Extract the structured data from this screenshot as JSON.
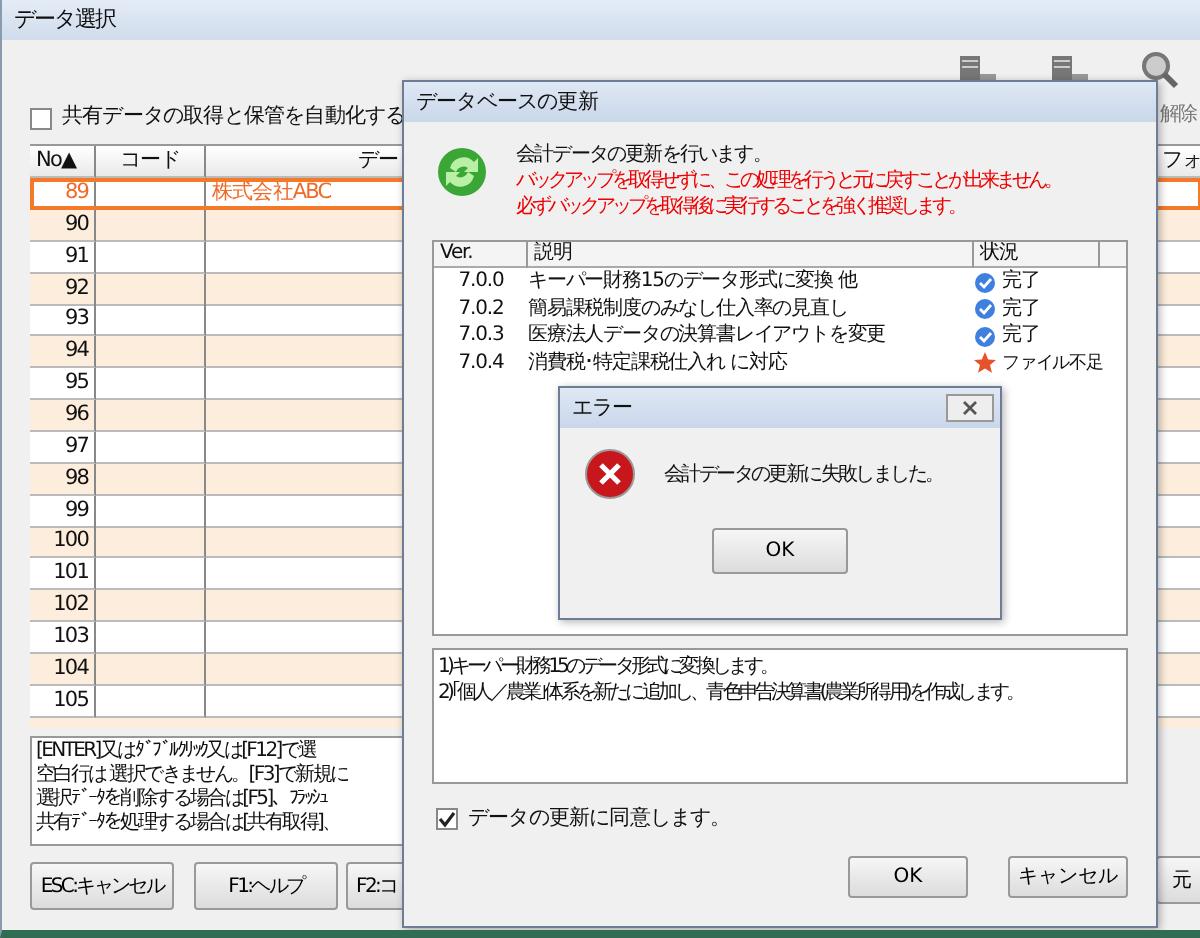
{
  "window": {
    "title": "データ選択"
  },
  "toolbar": {
    "label": "解除"
  },
  "auto_share": {
    "label": "共有データの取得と保管を自動化する",
    "checked": false
  },
  "table": {
    "columns": [
      "No▲",
      "コード",
      "デー",
      "フォ"
    ],
    "rows": [
      {
        "no": "89",
        "name": "株式会社ABC",
        "selected": true
      },
      {
        "no": "90",
        "selected": false
      },
      {
        "no": "91",
        "selected": false
      },
      {
        "no": "92",
        "selected": false
      },
      {
        "no": "93",
        "selected": false
      },
      {
        "no": "94",
        "selected": false
      },
      {
        "no": "95",
        "selected": false
      },
      {
        "no": "96",
        "selected": false
      },
      {
        "no": "97",
        "selected": false
      },
      {
        "no": "98",
        "selected": false
      },
      {
        "no": "99",
        "selected": false
      },
      {
        "no": "100",
        "selected": false
      },
      {
        "no": "101",
        "selected": false
      },
      {
        "no": "102",
        "selected": false
      },
      {
        "no": "103",
        "selected": false
      },
      {
        "no": "104",
        "selected": false
      },
      {
        "no": "105",
        "selected": false
      }
    ]
  },
  "help_lines": [
    "[ENTER]又はﾀﾞﾌﾞﾙｸﾘｯｸ又は[F12]で選",
    "空白行は 選択できません。[F3]で新規に",
    "選択ﾃﾞｰﾀを削除する場合は[F5]、ﾌﾗｯｼｭ",
    "共有ﾃﾞｰﾀを処理する場合は[共有取得]、"
  ],
  "buttons": [
    "ESC:キャンセル",
    "F1:ヘルプ",
    "F2:コ"
  ],
  "right_button": "元",
  "update_dialog": {
    "title": "データベースの更新",
    "message": "会計データの更新を行います。",
    "warnings": [
      "バックアップを取得せずに、この処理を行うと元に戻すことが出来ません。",
      "必ずバックアップを取得後に実行することを強く推奨します。"
    ],
    "columns": [
      "Ver.",
      "説明",
      "状況"
    ],
    "versions": [
      {
        "ver": "7.0.0",
        "description": "キーパー財務15のデータ形式に変換 他",
        "status": "完了",
        "kind": "done"
      },
      {
        "ver": "7.0.2",
        "description": "簡易課税制度のみなし仕入率の見直し",
        "status": "完了",
        "kind": "done"
      },
      {
        "ver": "7.0.3",
        "description": "医療法人データの決算書レイアウトを変更",
        "status": "完了",
        "kind": "done"
      },
      {
        "ver": "7.0.4",
        "description": "消費税･特定課税仕入れ に対応",
        "status": "ファイル不足",
        "kind": "missing"
      }
    ],
    "details": [
      "1)キーパー財務15のデータ形式に変換します。",
      "2)｢個人／農業｣体系を新たに追加し、青色申告決算書(農業所得用)を作成します。"
    ],
    "agree": {
      "label": "データの更新に同意します。",
      "checked": true
    },
    "buttons": [
      "OK",
      "キャンセル"
    ]
  },
  "error_dialog": {
    "title": "エラー",
    "message": "会計データの更新に失敗しました。",
    "button": "OK"
  }
}
